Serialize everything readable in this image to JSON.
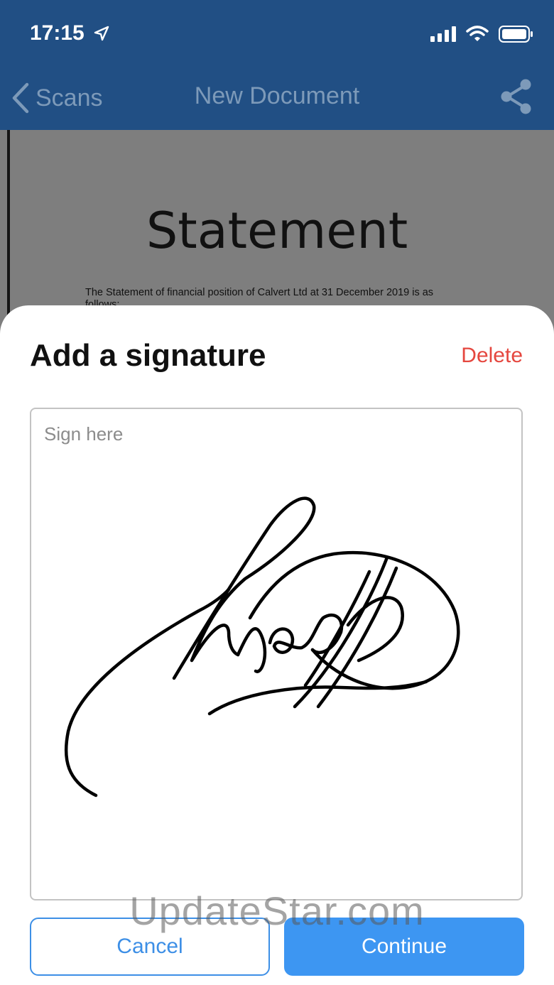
{
  "status_bar": {
    "time": "17:15",
    "icons": [
      "location-arrow-icon",
      "cellular-signal-icon",
      "wifi-icon",
      "battery-icon"
    ]
  },
  "nav": {
    "back_label": "Scans",
    "title": "New Document",
    "share_icon": "share-icon"
  },
  "document": {
    "title": "Statement",
    "body_line1": "The Statement of financial position of Calvert Ltd at 31 December 2019 is as",
    "body_line2": "follows:"
  },
  "sheet": {
    "title": "Add a signature",
    "delete_label": "Delete",
    "placeholder": "Sign here",
    "cancel_label": "Cancel",
    "continue_label": "Continue"
  },
  "watermark": "UpdateStar.com",
  "colors": {
    "header_bg": "#214f84",
    "delete": "#e5473f",
    "primary": "#3d96f2"
  }
}
